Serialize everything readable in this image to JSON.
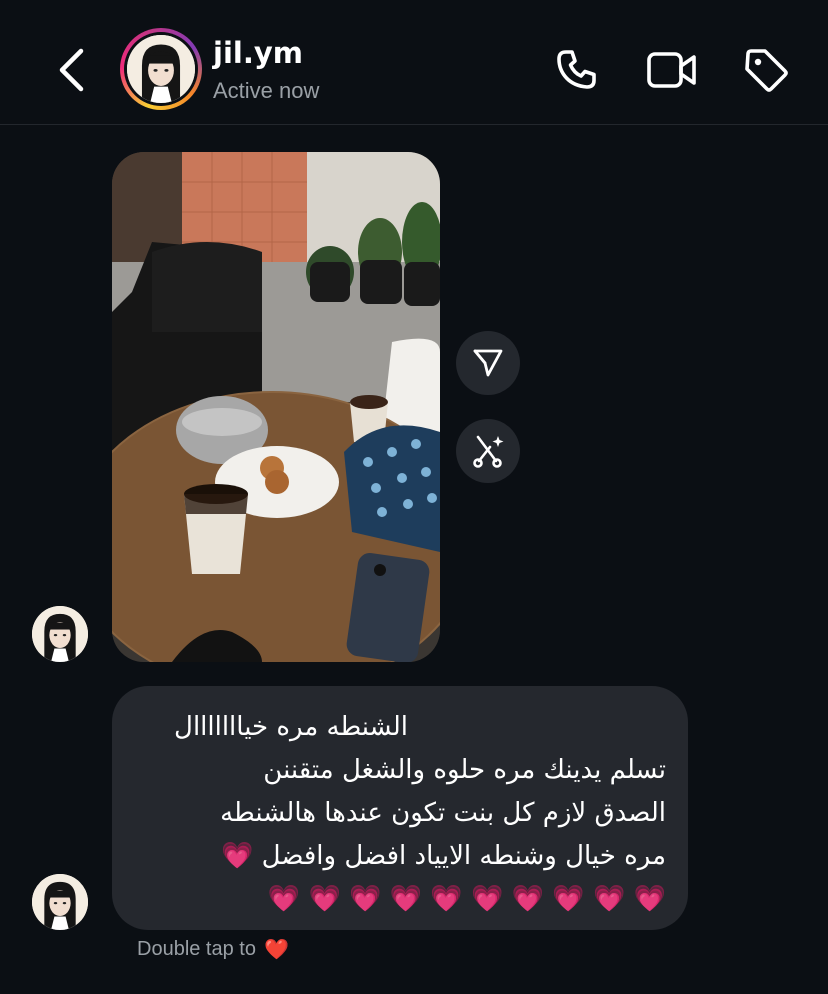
{
  "header": {
    "username": "jil.ym",
    "status": "Active now"
  },
  "message": {
    "lines": [
      "الشنطه مره خيااااااال",
      "تسلم يدينك مره حلوه والشغل متقننن",
      "الصدق لازم كل بنت تكون عندها هالشنطه",
      "مره خيال وشنطه الايياد افضل وافضل 💗",
      "💗 💗 💗 💗 💗 💗 💗 💗 💗 💗"
    ]
  },
  "reaction_hint": {
    "text": "Double tap to",
    "emoji": "❤️"
  },
  "colors": {
    "background": "#0b0f14",
    "bubble": "#25282e",
    "action_button": "#24282e",
    "secondary_text": "#9aa0a6"
  },
  "icons": {
    "back": "chevron-left-icon",
    "call": "phone-icon",
    "video": "video-camera-icon",
    "tag": "tag-icon",
    "share": "send-icon",
    "remix": "remix-icon"
  }
}
